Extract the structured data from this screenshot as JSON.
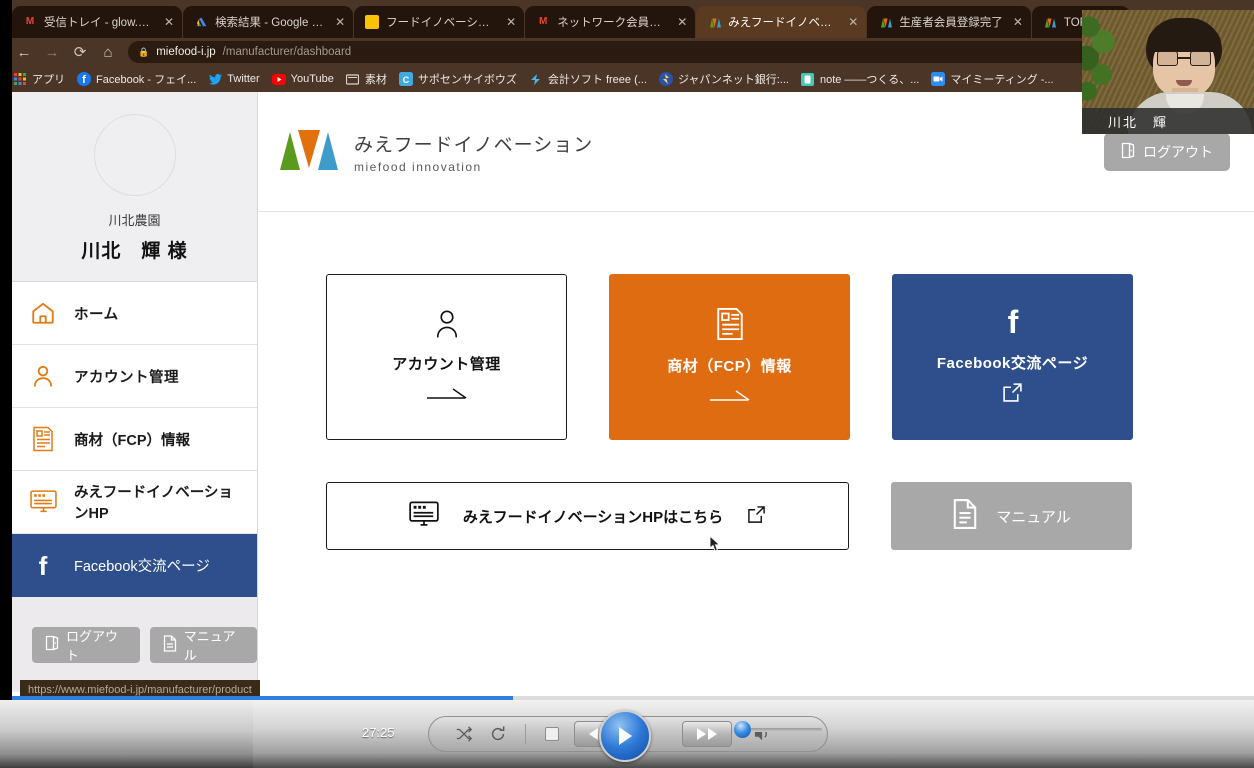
{
  "browser": {
    "tabs": [
      {
        "title": "受信トレイ - glow.with",
        "favicon": "gmail-icon",
        "active": false
      },
      {
        "title": "検索結果 - Google ドラ",
        "favicon": "google-drive-icon",
        "active": false
      },
      {
        "title": "フードイノベーション研",
        "favicon": "document-icon",
        "active": false
      },
      {
        "title": "ネットワーク会員登録あ",
        "favicon": "gmail-icon",
        "active": false
      },
      {
        "title": "みえフードイノベーショ",
        "favicon": "miefood-icon",
        "active": true
      },
      {
        "title": "生産者会員登録完了",
        "favicon": "miefood-icon",
        "active": false
      },
      {
        "title": "TOPページ",
        "favicon": "miefood-icon",
        "active": false
      }
    ],
    "close_label": "✕",
    "nav": {
      "back": "←",
      "forward": "→",
      "reload": "⟳",
      "home": "⌂"
    },
    "omnibox": {
      "lock_icon": "lock-icon",
      "host": "miefood-i.jp",
      "path": "/manufacturer/dashboard",
      "star_icon": "bookmark-star-icon"
    },
    "bookmarks": [
      {
        "label": "アプリ",
        "icon": "apps-grid-icon"
      },
      {
        "label": "Facebook - フェイ...",
        "icon": "facebook-icon"
      },
      {
        "label": "Twitter",
        "icon": "twitter-icon"
      },
      {
        "label": "YouTube",
        "icon": "youtube-icon"
      },
      {
        "label": "素材",
        "icon": "folder-icon"
      },
      {
        "label": "サポセンサイボウズ",
        "icon": "cybozu-icon"
      },
      {
        "label": "会計ソフト freee (...",
        "icon": "freee-icon"
      },
      {
        "label": "ジャパンネット銀行:...",
        "icon": "japannet-icon"
      },
      {
        "label": "note ――つくる、...",
        "icon": "note-icon"
      },
      {
        "label": "マイミーティング -...",
        "icon": "meeting-icon"
      }
    ],
    "status_url": "https://www.miefood-i.jp/manufacturer/product"
  },
  "sidebar": {
    "avatar_icon": "avatar-placeholder-icon",
    "farm_name": "川北農園",
    "user_name": "川北　輝 様",
    "items": [
      {
        "label": "ホーム",
        "icon": "home-icon",
        "active": false
      },
      {
        "label": "アカウント管理",
        "icon": "person-icon",
        "active": false
      },
      {
        "label": "商材（FCP）情報",
        "icon": "document-list-icon",
        "active": false
      },
      {
        "label": "みえフードイノベーションHP",
        "icon": "monitor-icon",
        "active": false
      },
      {
        "label": "Facebook交流ページ",
        "icon": "facebook-icon",
        "active": true
      }
    ],
    "footer_buttons": [
      {
        "label": "ログアウト",
        "icon": "logout-door-icon"
      },
      {
        "label": "マニュアル",
        "icon": "manual-page-icon"
      }
    ]
  },
  "header": {
    "brand_title": "みえフードイノベーション",
    "brand_subtitle": "miefood innovation",
    "logo_icon": "miefood-triangles-logo",
    "logo_colors": [
      "#5a9b1e",
      "#e2700c",
      "#3f9cc9"
    ],
    "logout_label": "ログアウト",
    "logout_icon": "logout-door-icon"
  },
  "main": {
    "tiles": [
      {
        "label": "アカウント管理",
        "icon": "person-icon",
        "arrow": "⟶",
        "style": "outline",
        "color": "#ffffff"
      },
      {
        "label": "商材（FCP）情報",
        "icon": "document-list-icon",
        "arrow": "⟶",
        "style": "filled",
        "color": "#df6c10"
      },
      {
        "label": "Facebook交流ページ",
        "icon": "facebook-f-icon",
        "arrow": "external-link-icon",
        "style": "filled",
        "color": "#2e4f8c"
      }
    ],
    "wide_button": {
      "label": "みえフードイノベーションHPはこちら",
      "icon": "monitor-icon",
      "suffix_icon": "external-link-icon"
    },
    "manual_button": {
      "label": "マニュアル",
      "icon": "manual-page-icon",
      "color": "#a8a8a8"
    }
  },
  "webcam": {
    "speaker_name": "川北　輝"
  },
  "player": {
    "time": "27:25",
    "buttons": [
      {
        "name": "shuffle-button",
        "glyph": "⤭"
      },
      {
        "name": "loop-button",
        "glyph": "↻"
      },
      {
        "name": "stop-button",
        "glyph": "■"
      },
      {
        "name": "rewind-button",
        "glyph": "◀◀"
      },
      {
        "name": "play-button",
        "glyph": "▶"
      },
      {
        "name": "forward-button",
        "glyph": "▶▶"
      },
      {
        "name": "volume-button",
        "glyph": "🔊"
      }
    ]
  }
}
